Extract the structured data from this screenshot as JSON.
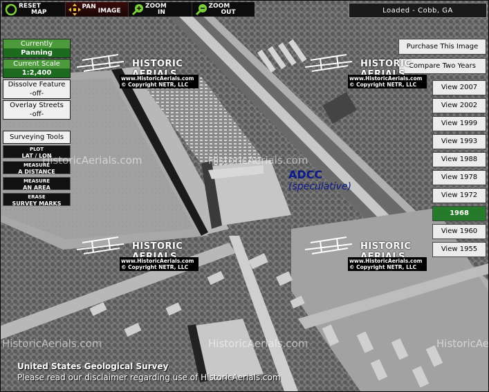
{
  "toolbar": {
    "reset": {
      "line1": "RESET",
      "line2": "MAP"
    },
    "pan": {
      "line1": "PAN",
      "line2": "IMAGE"
    },
    "zoom_in": {
      "line1": "ZOOM",
      "line2": "IN"
    },
    "zoom_out": {
      "line1": "ZOOM",
      "line2": "OUT"
    }
  },
  "status": "Loaded - Cobb, GA",
  "left_panel": {
    "currently_label": "Currently",
    "currently_value": "Panning",
    "scale_label": "Current Scale",
    "scale_value": "1:2,400",
    "dissolve_label": "Dissolve Feature",
    "dissolve_value": "-off-",
    "overlay_label": "Overlay Streets",
    "overlay_value": "-off-",
    "surveying_title": "Surveying Tools",
    "tools": [
      {
        "line1": "PLOT",
        "line2": "LAT / LON"
      },
      {
        "line1": "MEASURE",
        "line2": "A DISTANCE"
      },
      {
        "line1": "MEASURE",
        "line2": "AN AREA"
      },
      {
        "line1": "ERASE",
        "line2": "SURVEY MARKS"
      }
    ]
  },
  "right_panel": {
    "purchase": "Purchase This Image",
    "compare": "Compare Two Years",
    "years": [
      "View 2007",
      "View 2002",
      "View 1999",
      "View 1993",
      "View 1988",
      "View 1978",
      "View 1972",
      "1968",
      "View 1960",
      "View 1955"
    ],
    "active_year": "1968"
  },
  "map": {
    "label": "ADCC",
    "sublabel": "(speculative)",
    "watermark": "HistoricAerials.com",
    "logo_brand": "HISTORIC AERIALS",
    "logo_url": "www.HistoricAerials.com",
    "logo_copyright": "© Copyright NETR, LLC",
    "footer_title": "United States Geological Survey",
    "footer_disclaimer": "Please read our disclaimer regarding use of HistoricAerials.com"
  },
  "colors": {
    "active_green": "#267b2a",
    "label_blue": "#0c1a8a",
    "toolbar_bg": "#0c0c0c"
  }
}
